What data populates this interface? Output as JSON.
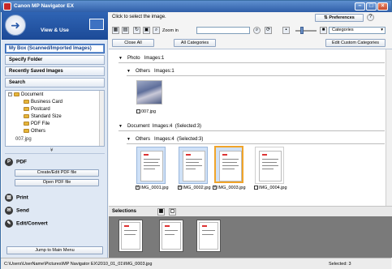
{
  "window": {
    "title": "Canon MP Navigator EX"
  },
  "sidebar": {
    "header": "View & Use",
    "items": [
      {
        "label": "My Box (Scanned/Imported Images)",
        "selected": true
      },
      {
        "label": "Specify Folder"
      },
      {
        "label": "Recently Saved Images"
      },
      {
        "label": "Search"
      }
    ],
    "tree": {
      "root": "Document",
      "children": [
        "Business Card",
        "Postcard",
        "Standard Size",
        "PDF File",
        "Others"
      ],
      "next": "007.jpg"
    },
    "pdf": {
      "label": "PDF",
      "create_button": "Create/Edit PDF file",
      "open_button": "Open PDF file"
    },
    "print": "Print",
    "send": "Send",
    "edit": "Edit/Convert",
    "jump_button": "Jump to Main Menu"
  },
  "toolbar": {
    "hint": "Click to select the image.",
    "preferences": "Preferences",
    "zoom_label": "Zoom in",
    "close_all": "Close All",
    "all_categories": "All Categories",
    "categories_select": "Categories",
    "edit_custom": "Edit Custom Categories"
  },
  "groups": {
    "photo": {
      "label": "Photo",
      "count": "Images:1",
      "sub": {
        "label": "Others",
        "count": "Images:1",
        "item": "007.jpg"
      }
    },
    "document": {
      "label": "Document",
      "count": "Images:4",
      "selected": "(Selected:3)",
      "sub": {
        "label": "Others",
        "count": "Images:4",
        "selected": "(Selected:3)"
      },
      "items": [
        {
          "name": "IMG_0001.jpg",
          "checked": true
        },
        {
          "name": "IMG_0002.jpg",
          "checked": true
        },
        {
          "name": "IMG_0003.jpg",
          "checked": true
        },
        {
          "name": "IMG_0004.jpg",
          "checked": false
        }
      ]
    }
  },
  "selections": {
    "label": "Selections"
  },
  "statusbar": {
    "path": "C:\\Users\\UserName\\Pictures\\MP Navigator EX\\2010_01_01\\IMG_0003.jpg",
    "selected": "Selected: 3"
  },
  "colors": {
    "accent": "#2f64b4",
    "titlebar": "#3a6ea5",
    "current_frame": "#f0a42a",
    "tray": "#7a7a7a"
  }
}
